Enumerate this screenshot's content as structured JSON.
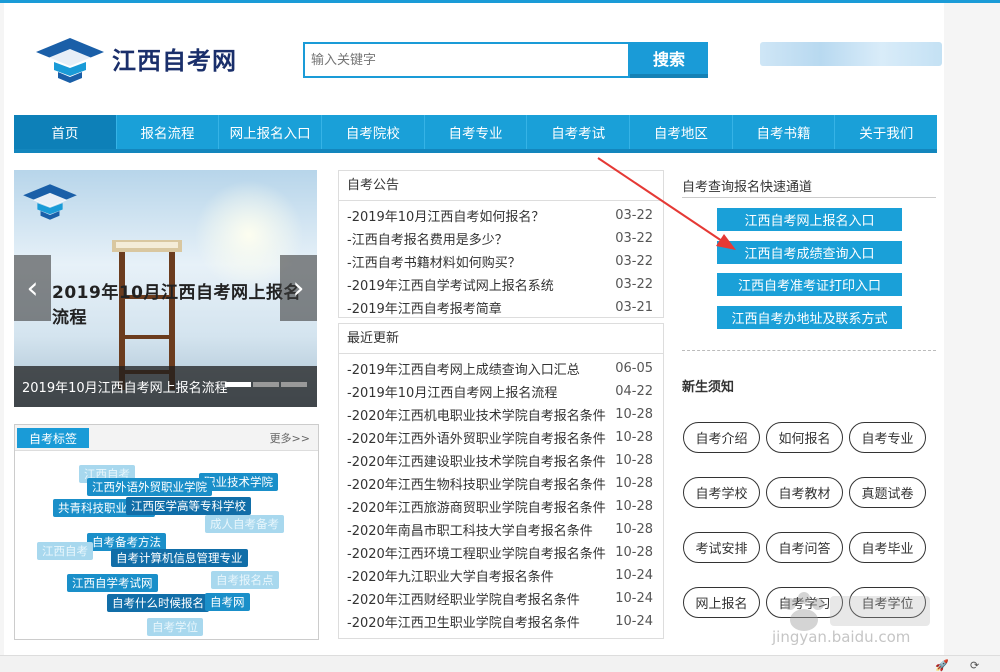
{
  "header": {
    "logo_text": "江西自考网",
    "search_placeholder": "输入关键字",
    "search_button": "搜索"
  },
  "nav": [
    {
      "label": "首页",
      "active": true
    },
    {
      "label": "报名流程"
    },
    {
      "label": "网上报名入口"
    },
    {
      "label": "自考院校"
    },
    {
      "label": "自考专业"
    },
    {
      "label": "自考考试"
    },
    {
      "label": "自考地区"
    },
    {
      "label": "自考书籍"
    },
    {
      "label": "关于我们"
    }
  ],
  "carousel": {
    "big_caption": "2019年10月江西自考网上报名流程",
    "bottom_title": "2019年10月江西自考网上报名流程",
    "prev_icon": "chevron-left-icon",
    "next_icon": "chevron-right-icon"
  },
  "tags": {
    "title": "自考标签",
    "more": "更多>>",
    "items": [
      "江西外语外贸职业学院",
      "职业技术学院",
      "共青科技职业学院",
      "江西医学高等专科学校",
      "成人自考备考",
      "自考备考方法",
      "自考计算机信息管理专业",
      "江西自学考试网",
      "自考报名点",
      "自考什么时候报名",
      "自考网",
      "自考学位",
      "江西自考"
    ]
  },
  "notice": {
    "title": "自考公告",
    "items": [
      {
        "title": "-2019年10月江西自考如何报名？",
        "date": "03-22"
      },
      {
        "title": "-江西自考报名费用是多少？",
        "date": "03-22"
      },
      {
        "title": "-江西自考书籍材料如何购买？",
        "date": "03-22"
      },
      {
        "title": "-2019年江西自学考试网上报名系统",
        "date": "03-22"
      },
      {
        "title": "-2019年江西自考报考简章",
        "date": "03-21"
      }
    ]
  },
  "updates": {
    "title": "最近更新",
    "items": [
      {
        "title": "-2019年江西自考网上成绩查询入口汇总",
        "date": "06-05"
      },
      {
        "title": "-2019年10月江西自考网上报名流程",
        "date": "04-22"
      },
      {
        "title": "-2020年江西机电职业技术学院自考报名条件",
        "date": "10-28"
      },
      {
        "title": "-2020年江西外语外贸职业学院自考报名条件",
        "date": "10-28"
      },
      {
        "title": "-2020年江西建设职业技术学院自考报名条件",
        "date": "10-28"
      },
      {
        "title": "-2020年江西生物科技职业学院自考报名条件",
        "date": "10-28"
      },
      {
        "title": "-2020年江西旅游商贸职业学院自考报名条件",
        "date": "10-28"
      },
      {
        "title": "-2020年南昌市职工科技大学自考报名条件",
        "date": "10-28"
      },
      {
        "title": "-2020年江西环境工程职业学院自考报名条件",
        "date": "10-28"
      },
      {
        "title": "-2020年九江职业大学自考报名条件",
        "date": "10-24"
      },
      {
        "title": "-2020年江西财经职业学院自考报名条件",
        "date": "10-24"
      },
      {
        "title": "-2020年江西卫生职业学院自考报名条件",
        "date": "10-24"
      }
    ]
  },
  "quick": {
    "title": "自考查询报名快速通道",
    "buttons": [
      "江西自考网上报名入口",
      "江西自考成绩查询入口",
      "江西自考准考证打印入口",
      "江西自考办地址及联系方式"
    ]
  },
  "newbie": {
    "title": "新生须知",
    "pills": [
      "自考介绍",
      "如何报名",
      "自考专业",
      "自考学校",
      "自考教材",
      "真题试卷",
      "考试安排",
      "自考问答",
      "自考毕业",
      "网上报名",
      "自考学习",
      "自考学位"
    ]
  },
  "watermark": {
    "text": "jingyan.baidu.com"
  },
  "colors": {
    "accent": "#1a9bd7",
    "nav_active": "#0d80b8",
    "annotation_arrow": "#e53935"
  }
}
